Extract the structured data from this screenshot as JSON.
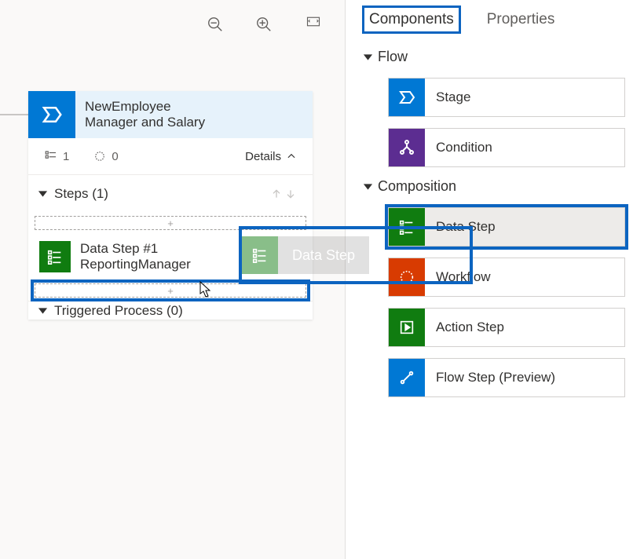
{
  "toolbar": {
    "zoom_out": "zoom-out",
    "zoom_in": "zoom-in",
    "fullscreen": "fit-screen"
  },
  "stage": {
    "title_line1": "NewEmployee",
    "title_line2": "Manager and Salary",
    "fields_count": "1",
    "workflows_count": "0",
    "details_label": "Details",
    "steps_label": "Steps (1)",
    "steps": [
      {
        "name": "Data Step #1",
        "subname": "ReportingManager"
      }
    ],
    "dropzone_plus": "+",
    "triggered_label": "Triggered Process (0)"
  },
  "panel": {
    "tabs": {
      "components": "Components",
      "properties": "Properties"
    },
    "sections": {
      "flow": {
        "label": "Flow",
        "items": [
          {
            "key": "stage",
            "label": "Stage"
          },
          {
            "key": "condition",
            "label": "Condition"
          }
        ]
      },
      "composition": {
        "label": "Composition",
        "items": [
          {
            "key": "data",
            "label": "Data Step"
          },
          {
            "key": "workflow",
            "label": "Workflow"
          },
          {
            "key": "action",
            "label": "Action Step"
          },
          {
            "key": "flow",
            "label": "Flow Step (Preview)"
          }
        ]
      }
    }
  },
  "drag": {
    "label": "Data Step"
  }
}
